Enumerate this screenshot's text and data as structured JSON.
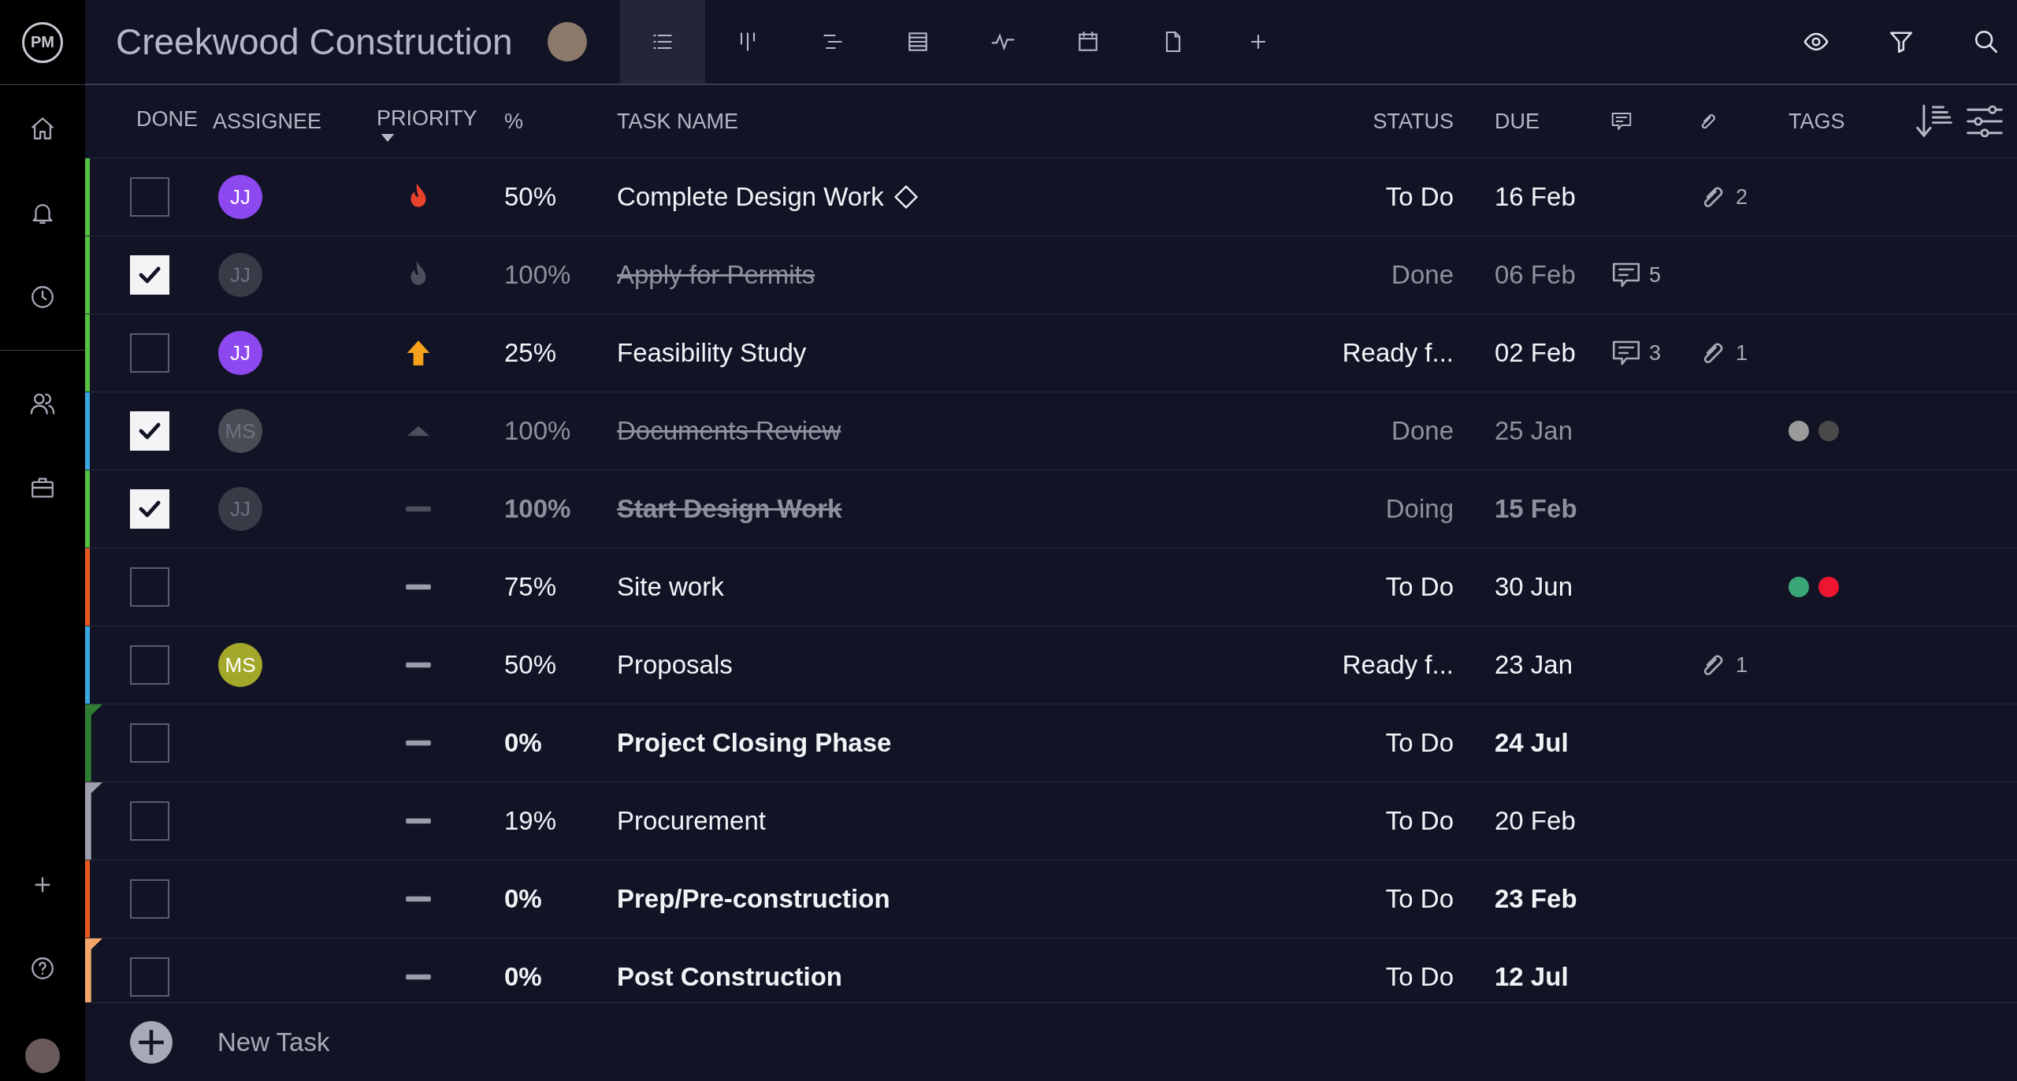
{
  "logo": "PM",
  "project": {
    "title": "Creekwood Construction"
  },
  "views": [
    {
      "kind": "list",
      "selected": true
    },
    {
      "kind": "board",
      "selected": false
    },
    {
      "kind": "gantt",
      "selected": false
    },
    {
      "kind": "sheet",
      "selected": false
    },
    {
      "kind": "dashboard",
      "selected": false
    },
    {
      "kind": "calendar",
      "selected": false
    },
    {
      "kind": "files",
      "selected": false
    },
    {
      "kind": "add",
      "selected": false
    }
  ],
  "columns": {
    "done": "DONE",
    "assignee": "ASSIGNEE",
    "priority": "PRIORITY",
    "percent": "%",
    "task_name": "TASK NAME",
    "status": "STATUS",
    "due": "DUE",
    "tags": "TAGS"
  },
  "rows": [
    {
      "bar": {
        "kind": "line",
        "color": "#56c23f"
      },
      "done": false,
      "bold": false,
      "milestone": true,
      "assignee": {
        "initials": "JJ",
        "color": "#8e48f0"
      },
      "priority": {
        "kind": "critical"
      },
      "percent": "50%",
      "name": "Complete Design Work",
      "status": "To Do",
      "due": "16 Feb",
      "comments": "",
      "attachments": "2",
      "tags": []
    },
    {
      "bar": {
        "kind": "line",
        "color": "#56c23f"
      },
      "done": true,
      "bold": false,
      "milestone": false,
      "assignee": {
        "initials": "JJ",
        "color": "#383a45"
      },
      "priority": {
        "kind": "critical"
      },
      "percent": "100%",
      "name": "Apply for Permits",
      "status": "Done",
      "due": "06 Feb",
      "comments": "5",
      "attachments": "",
      "tags": []
    },
    {
      "bar": {
        "kind": "line",
        "color": "#56c23f"
      },
      "done": false,
      "bold": false,
      "milestone": false,
      "assignee": {
        "initials": "JJ",
        "color": "#8e48f0"
      },
      "priority": {
        "kind": "high"
      },
      "percent": "25%",
      "name": "Feasibility Study",
      "status": "Ready f...",
      "due": "02 Feb",
      "comments": "3",
      "attachments": "1",
      "tags": []
    },
    {
      "bar": {
        "kind": "line",
        "color": "#38a8e0"
      },
      "done": true,
      "bold": false,
      "milestone": false,
      "assignee": {
        "initials": "MS",
        "color": "#4a4c55"
      },
      "priority": {
        "kind": "medium"
      },
      "percent": "100%",
      "name": "Documents Review",
      "status": "Done",
      "due": "25 Jan",
      "comments": "",
      "attachments": "",
      "tags": [
        {
          "color": "#9b9b9b"
        },
        {
          "color": "#4a4a4a"
        }
      ]
    },
    {
      "bar": {
        "kind": "line",
        "color": "#56c23f"
      },
      "done": true,
      "bold": true,
      "milestone": false,
      "assignee": {
        "initials": "JJ",
        "color": "#383a45"
      },
      "priority": {
        "kind": "low"
      },
      "percent": "100%",
      "name": "Start Design Work",
      "status": "Doing",
      "due": "15 Feb",
      "comments": "",
      "attachments": "",
      "tags": []
    },
    {
      "bar": {
        "kind": "line",
        "color": "#ea5a1c"
      },
      "done": false,
      "bold": false,
      "milestone": false,
      "priority": {
        "kind": "low"
      },
      "percent": "75%",
      "name": "Site work",
      "status": "To Do",
      "due": "30 Jun",
      "comments": "",
      "attachments": "",
      "tags": [
        {
          "color": "#3aa676"
        },
        {
          "color": "#ee1530"
        }
      ]
    },
    {
      "bar": {
        "kind": "line",
        "color": "#38a8e0"
      },
      "done": false,
      "bold": false,
      "milestone": false,
      "assignee": {
        "initials": "MS",
        "color": "#a3a82a"
      },
      "priority": {
        "kind": "low"
      },
      "percent": "50%",
      "name": "Proposals",
      "status": "Ready f...",
      "due": "23 Jan",
      "comments": "",
      "attachments": "1",
      "tags": []
    },
    {
      "bar": {
        "kind": "flag",
        "color": "#2e7d32"
      },
      "done": false,
      "bold": true,
      "milestone": false,
      "priority": {
        "kind": "low"
      },
      "percent": "0%",
      "name": "Project Closing Phase",
      "status": "To Do",
      "due": "24 Jul",
      "comments": "",
      "attachments": "",
      "tags": []
    },
    {
      "bar": {
        "kind": "flag",
        "color": "#9d9fab"
      },
      "done": false,
      "bold": false,
      "milestone": false,
      "priority": {
        "kind": "low"
      },
      "percent": "19%",
      "name": "Procurement",
      "status": "To Do",
      "due": "20 Feb",
      "comments": "",
      "attachments": "",
      "tags": []
    },
    {
      "bar": {
        "kind": "line",
        "color": "#ea5a1c"
      },
      "done": false,
      "bold": true,
      "milestone": false,
      "priority": {
        "kind": "low"
      },
      "percent": "0%",
      "name": "Prep/Pre-construction",
      "status": "To Do",
      "due": "23 Feb",
      "comments": "",
      "attachments": "",
      "tags": []
    },
    {
      "bar": {
        "kind": "flag",
        "color": "#f4a66a"
      },
      "done": false,
      "bold": true,
      "milestone": false,
      "priority": {
        "kind": "low"
      },
      "percent": "0%",
      "name": "Post Construction",
      "status": "To Do",
      "due": "12 Jul",
      "comments": "",
      "attachments": "",
      "tags": []
    }
  ],
  "new_task": "New Task"
}
